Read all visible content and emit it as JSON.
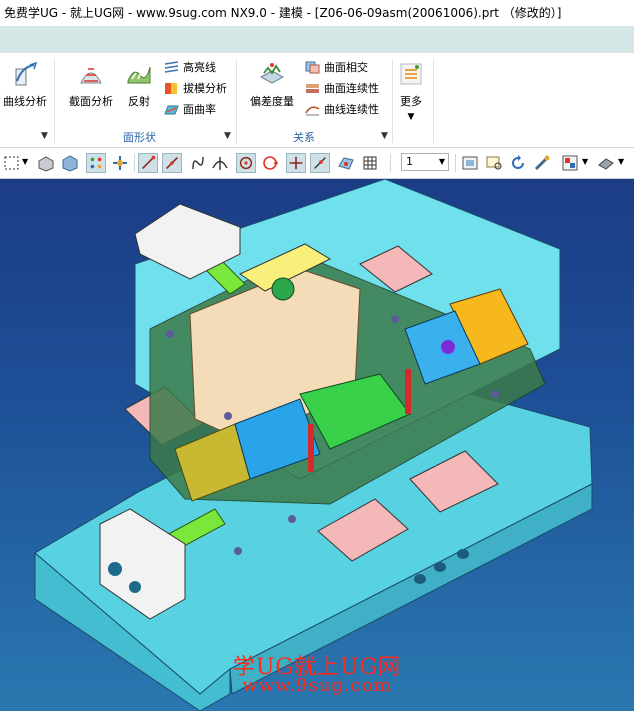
{
  "window": {
    "title": "免费学UG - 就上UG网 - www.9sug.com NX9.0 - 建模 - [Z06-06-09asm(20061006).prt （修改的）]"
  },
  "ribbon": {
    "curve_analysis": "曲线分析",
    "section_analysis": "截面分析",
    "reflection": "反射",
    "highlight_lines": "高亮线",
    "draft_analysis": "拔模分析",
    "surface_curvature": "面曲率",
    "shape_group": "面形状",
    "deviation_gauge": "偏差度量",
    "surface_intersection": "曲面相交",
    "surface_continuity": "曲面连续性",
    "curve_continuity": "曲线连续性",
    "relation_group": "关系",
    "more": "更多"
  },
  "toolbar": {
    "selection_value": "1"
  },
  "viewport": {
    "watermark_line1": "学UG就上UG网",
    "watermark_line2": "www.9sug.com"
  },
  "colors": {
    "tab_strip": "#d5e6e6",
    "viewport_top": "#1c3c86",
    "mold_base": "#5fdbe8",
    "watermark": "#ff2a1a"
  }
}
